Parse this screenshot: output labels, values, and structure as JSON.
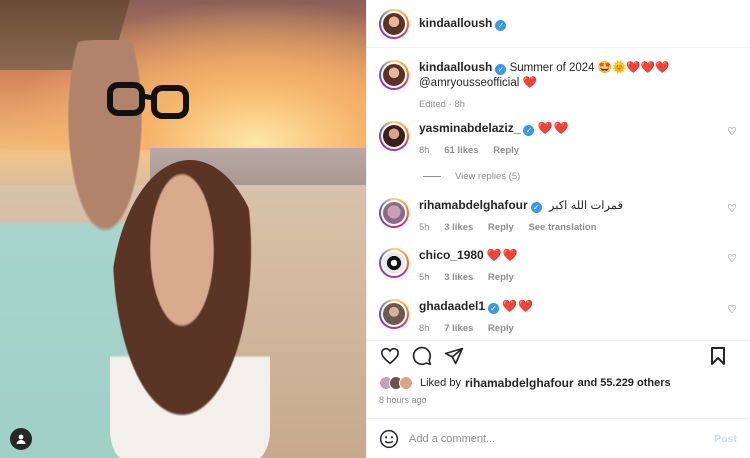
{
  "post": {
    "author": "kindaalloush",
    "caption_author": "kindaalloush",
    "caption_text": "Summer of 2024 🤩🌞❤️❤️❤️",
    "mention": "@amryousseofficial ❤️",
    "edited": "Edited · 8h"
  },
  "comments": [
    {
      "user": "yasminabdelaziz_",
      "text": "❤️❤️",
      "time": "8h",
      "likes": "61 likes",
      "reply": "Reply"
    },
    {
      "user": "rihamabdelghafour",
      "text": "قمرات الله اكبر",
      "time": "5h",
      "likes": "3 likes",
      "reply": "Reply",
      "translate": "See translation"
    },
    {
      "user": "chico_1980",
      "text": "❤️❤️",
      "time": "5h",
      "likes": "3 likes",
      "reply": "Reply"
    },
    {
      "user": "ghadaadel1",
      "text": "❤️❤️",
      "time": "8h",
      "likes": "7 likes",
      "reply": "Reply"
    }
  ],
  "view_replies": "View replies (5)",
  "likes": {
    "prefix": "Liked by",
    "user": "rihamabdelghafour",
    "suffix": "and 55.229 others"
  },
  "timestamp": "8 hours ago",
  "add_comment": {
    "placeholder": "Add a comment...",
    "post_label": "Post"
  },
  "icons": {
    "like": "heart-icon",
    "comment": "comment-icon",
    "share": "share-icon",
    "save": "bookmark-icon",
    "emoji": "emoji-icon",
    "tagged": "person-icon"
  },
  "colors": {
    "verified": "#3897f0",
    "heart": "#ed4956",
    "muted": "#8e8e8e"
  }
}
